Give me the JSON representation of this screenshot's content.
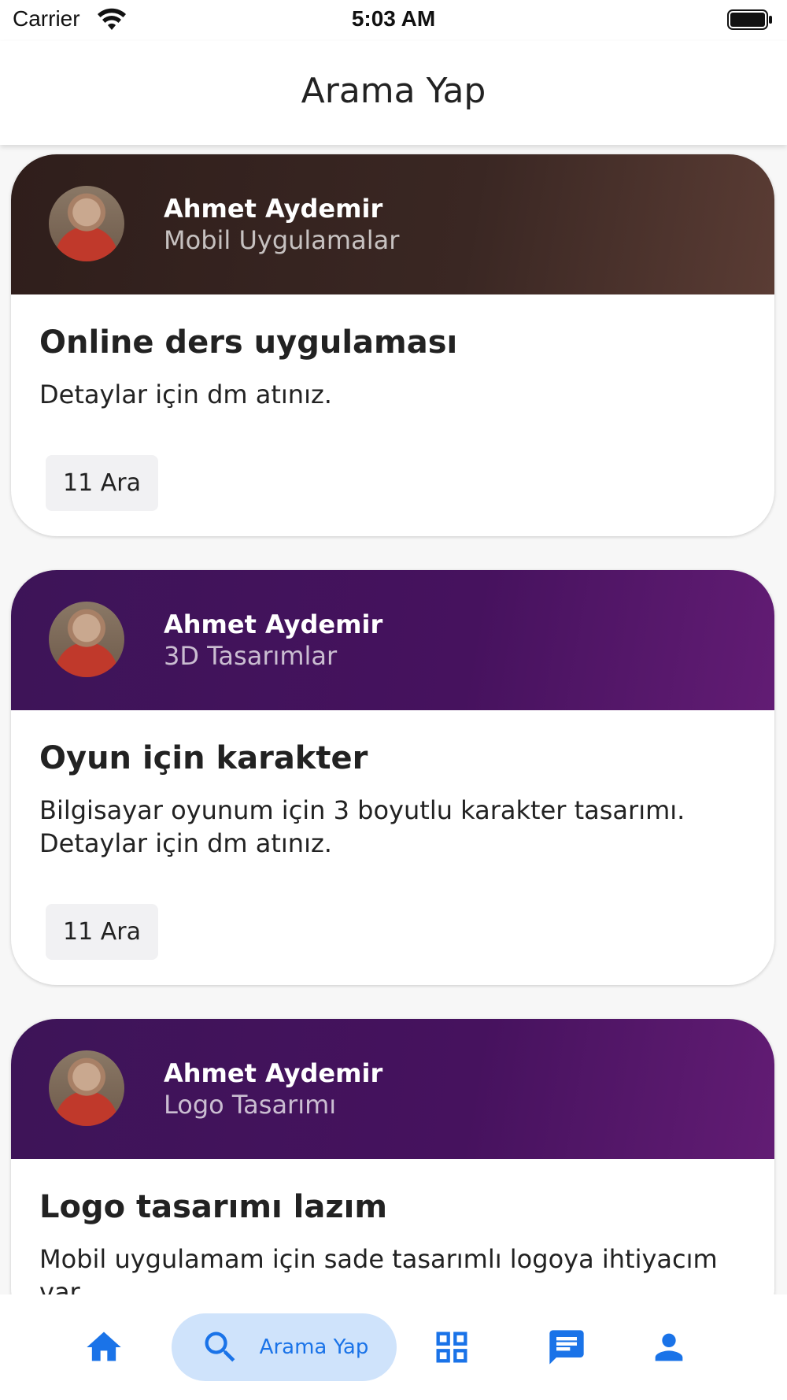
{
  "status_bar": {
    "carrier": "Carrier",
    "time": "5:03 AM"
  },
  "app_bar": {
    "title": "Arama Yap"
  },
  "cards": [
    {
      "author": "Ahmet Aydemir",
      "category": "Mobil Uygulamalar",
      "title": "Online ders uygulaması",
      "description": "Detaylar için dm atınız.",
      "date": "11 Ara",
      "header_color": "#2f1e1b"
    },
    {
      "author": "Ahmet Aydemir",
      "category": "3D Tasarımlar",
      "title": "Oyun için karakter",
      "description": "Bilgisayar oyunum için 3 boyutlu karakter tasarımı.\nDetaylar için dm atınız.",
      "date": "11 Ara",
      "header_color": "#46125e"
    },
    {
      "author": "Ahmet Aydemir",
      "category": "Logo Tasarımı",
      "title": "Logo tasarımı lazım",
      "description": "Mobil uygulamam için sade tasarımlı logoya ihtiyacım var",
      "date": "",
      "header_color": "#46125e"
    }
  ],
  "bottom_nav": {
    "items": [
      {
        "icon": "home-icon"
      },
      {
        "icon": "search-icon",
        "label": "Arama Yap",
        "active": true
      },
      {
        "icon": "grid-icon"
      },
      {
        "icon": "chat-icon"
      },
      {
        "icon": "person-icon"
      }
    ],
    "accent_color": "#1a73e8",
    "active_bg": "#cfe3fb"
  }
}
